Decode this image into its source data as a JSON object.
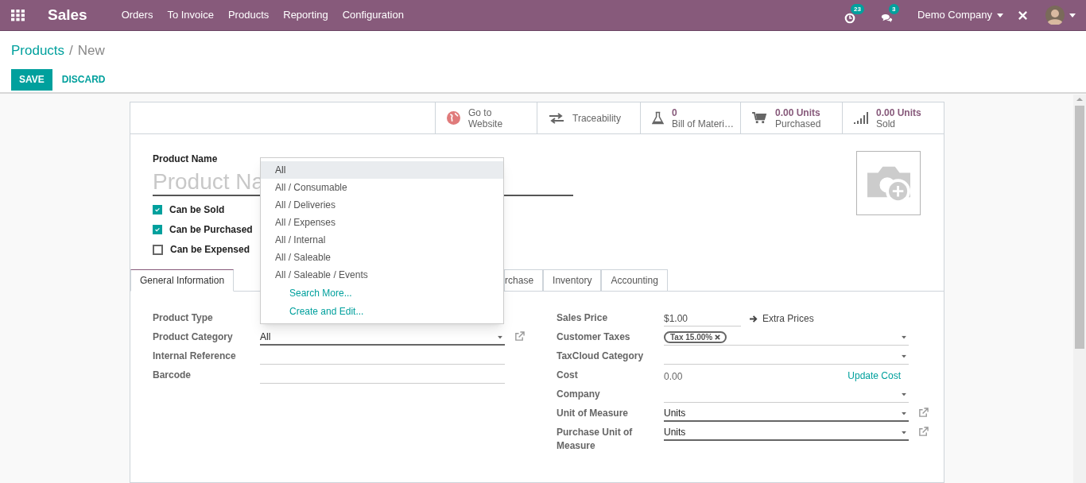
{
  "navbar": {
    "app": "Sales",
    "menu": [
      "Orders",
      "To Invoice",
      "Products",
      "Reporting",
      "Configuration"
    ],
    "activity_count": "23",
    "message_count": "3",
    "company": "Demo Company"
  },
  "breadcrumb": {
    "parent": "Products",
    "separator": "/",
    "current": "New"
  },
  "buttons": [
    {
      "label": "SAVE",
      "kind": "primary"
    },
    {
      "label": "DISCARD",
      "kind": "link"
    }
  ],
  "smart_buttons": [
    {
      "kind": "globe",
      "label": "Go to Website"
    },
    {
      "kind": "transfer",
      "label": "Traceability"
    },
    {
      "kind": "flask",
      "value": "0",
      "label": "Bill of Materi…"
    },
    {
      "kind": "cart",
      "value": "0.00 Units",
      "label": "Purchased"
    },
    {
      "kind": "bars",
      "value": "0.00 Units",
      "label": "Sold"
    }
  ],
  "product_name": {
    "label": "Product Name",
    "placeholder": "Product Na"
  },
  "checkboxes": [
    {
      "label": "Can be Sold",
      "checked": true
    },
    {
      "label": "Can be Purchased",
      "checked": true
    },
    {
      "label": "Can be Expensed",
      "checked": false
    }
  ],
  "tabs": [
    {
      "label": "General Information",
      "selected": true
    },
    {
      "label": "rchase",
      "selected": false
    },
    {
      "label": "Inventory",
      "selected": false
    },
    {
      "label": "Accounting",
      "selected": false
    }
  ],
  "left_fields": [
    {
      "label": "Product Type",
      "kind": "label_only"
    },
    {
      "label": "Product Category",
      "kind": "select",
      "value": "All",
      "required": true,
      "external_link": true
    },
    {
      "label": "Internal Reference",
      "kind": "input"
    },
    {
      "label": "Barcode",
      "kind": "input"
    }
  ],
  "right_fields": [
    {
      "label": "Sales Price",
      "kind": "price",
      "value": "$1.00",
      "link": "Extra Prices"
    },
    {
      "label": "Customer Taxes",
      "kind": "tags",
      "tags": [
        "Tax 15.00%"
      ]
    },
    {
      "label": "TaxCloud Category",
      "kind": "select"
    },
    {
      "label": "Cost",
      "kind": "readonly",
      "value": "0.00",
      "action": "Update Cost"
    },
    {
      "label": "Company",
      "kind": "select"
    },
    {
      "label": "Unit of Measure",
      "kind": "select",
      "value": "Units",
      "required": true,
      "external_link": true
    },
    {
      "label": "Purchase Unit of Measure",
      "kind": "select",
      "value": "Units",
      "required": true,
      "external_link": true
    }
  ],
  "dropdown": {
    "items": [
      {
        "label": "All",
        "selected": true
      },
      {
        "label": "All / Consumable",
        "selected": false
      },
      {
        "label": "All / Deliveries",
        "selected": false
      },
      {
        "label": "All / Expenses",
        "selected": false
      },
      {
        "label": "All / Internal",
        "selected": false
      },
      {
        "label": "All / Saleable",
        "selected": false
      },
      {
        "label": "All / Saleable / Events",
        "selected": false
      }
    ],
    "actions": [
      "Search More...",
      "Create and Edit..."
    ]
  }
}
